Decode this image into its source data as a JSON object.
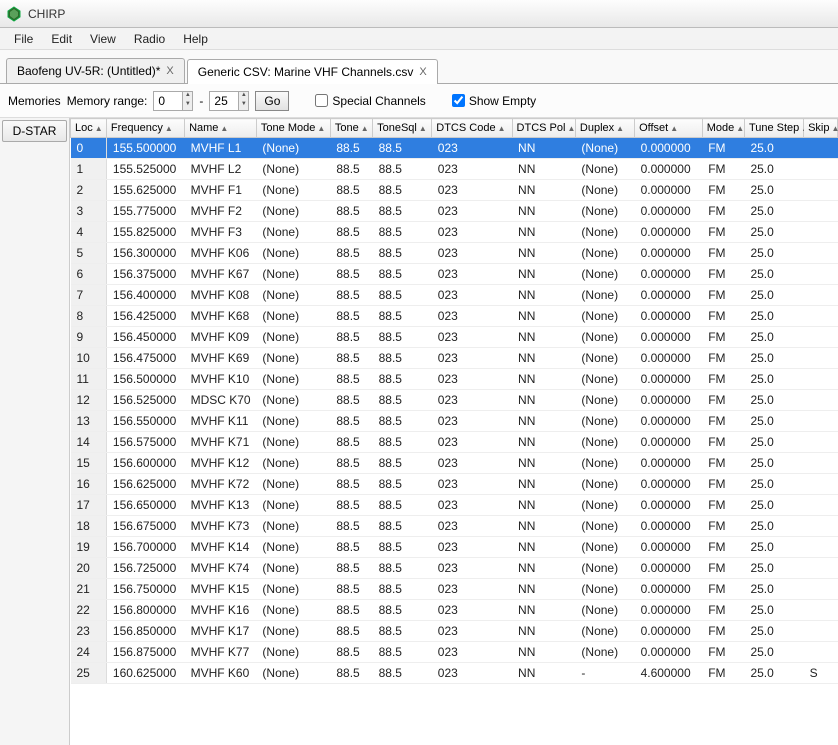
{
  "title": "CHIRP",
  "menu": [
    "File",
    "Edit",
    "View",
    "Radio",
    "Help"
  ],
  "tabs": [
    {
      "label": "Baofeng UV-5R: (Untitled)*",
      "close": "X",
      "active": false
    },
    {
      "label": "Generic CSV: Marine VHF Channels.csv",
      "close": "X",
      "active": true
    }
  ],
  "toolbar": {
    "memories_label": "Memories",
    "range_label": "Memory range:",
    "from": "0",
    "to": "25",
    "go": "Go",
    "dash": "-",
    "special_label": "Special Channels",
    "special_checked": false,
    "show_empty_label": "Show Empty",
    "show_empty_checked": true
  },
  "sidebar": {
    "dstar": "D-STAR"
  },
  "columns": [
    "Loc",
    "Frequency",
    "Name",
    "Tone Mode",
    "Tone",
    "ToneSql",
    "DTCS Code",
    "DTCS Pol",
    "Duplex",
    "Offset",
    "Mode",
    "Tune Step",
    "Skip"
  ],
  "rows": [
    {
      "loc": "0",
      "freq": "155.500000",
      "name": "MVHF L1",
      "tmode": "(None)",
      "tone": "88.5",
      "tsql": "88.5",
      "dtcs": "023",
      "pol": "NN",
      "dup": "(None)",
      "off": "0.000000",
      "mode": "FM",
      "tstep": "25.0",
      "skip": ""
    },
    {
      "loc": "1",
      "freq": "155.525000",
      "name": "MVHF L2",
      "tmode": "(None)",
      "tone": "88.5",
      "tsql": "88.5",
      "dtcs": "023",
      "pol": "NN",
      "dup": "(None)",
      "off": "0.000000",
      "mode": "FM",
      "tstep": "25.0",
      "skip": ""
    },
    {
      "loc": "2",
      "freq": "155.625000",
      "name": "MVHF F1",
      "tmode": "(None)",
      "tone": "88.5",
      "tsql": "88.5",
      "dtcs": "023",
      "pol": "NN",
      "dup": "(None)",
      "off": "0.000000",
      "mode": "FM",
      "tstep": "25.0",
      "skip": ""
    },
    {
      "loc": "3",
      "freq": "155.775000",
      "name": "MVHF F2",
      "tmode": "(None)",
      "tone": "88.5",
      "tsql": "88.5",
      "dtcs": "023",
      "pol": "NN",
      "dup": "(None)",
      "off": "0.000000",
      "mode": "FM",
      "tstep": "25.0",
      "skip": ""
    },
    {
      "loc": "4",
      "freq": "155.825000",
      "name": "MVHF F3",
      "tmode": "(None)",
      "tone": "88.5",
      "tsql": "88.5",
      "dtcs": "023",
      "pol": "NN",
      "dup": "(None)",
      "off": "0.000000",
      "mode": "FM",
      "tstep": "25.0",
      "skip": ""
    },
    {
      "loc": "5",
      "freq": "156.300000",
      "name": "MVHF K06",
      "tmode": "(None)",
      "tone": "88.5",
      "tsql": "88.5",
      "dtcs": "023",
      "pol": "NN",
      "dup": "(None)",
      "off": "0.000000",
      "mode": "FM",
      "tstep": "25.0",
      "skip": ""
    },
    {
      "loc": "6",
      "freq": "156.375000",
      "name": "MVHF K67",
      "tmode": "(None)",
      "tone": "88.5",
      "tsql": "88.5",
      "dtcs": "023",
      "pol": "NN",
      "dup": "(None)",
      "off": "0.000000",
      "mode": "FM",
      "tstep": "25.0",
      "skip": ""
    },
    {
      "loc": "7",
      "freq": "156.400000",
      "name": "MVHF K08",
      "tmode": "(None)",
      "tone": "88.5",
      "tsql": "88.5",
      "dtcs": "023",
      "pol": "NN",
      "dup": "(None)",
      "off": "0.000000",
      "mode": "FM",
      "tstep": "25.0",
      "skip": ""
    },
    {
      "loc": "8",
      "freq": "156.425000",
      "name": "MVHF K68",
      "tmode": "(None)",
      "tone": "88.5",
      "tsql": "88.5",
      "dtcs": "023",
      "pol": "NN",
      "dup": "(None)",
      "off": "0.000000",
      "mode": "FM",
      "tstep": "25.0",
      "skip": ""
    },
    {
      "loc": "9",
      "freq": "156.450000",
      "name": "MVHF K09",
      "tmode": "(None)",
      "tone": "88.5",
      "tsql": "88.5",
      "dtcs": "023",
      "pol": "NN",
      "dup": "(None)",
      "off": "0.000000",
      "mode": "FM",
      "tstep": "25.0",
      "skip": ""
    },
    {
      "loc": "10",
      "freq": "156.475000",
      "name": "MVHF K69",
      "tmode": "(None)",
      "tone": "88.5",
      "tsql": "88.5",
      "dtcs": "023",
      "pol": "NN",
      "dup": "(None)",
      "off": "0.000000",
      "mode": "FM",
      "tstep": "25.0",
      "skip": ""
    },
    {
      "loc": "11",
      "freq": "156.500000",
      "name": "MVHF K10",
      "tmode": "(None)",
      "tone": "88.5",
      "tsql": "88.5",
      "dtcs": "023",
      "pol": "NN",
      "dup": "(None)",
      "off": "0.000000",
      "mode": "FM",
      "tstep": "25.0",
      "skip": ""
    },
    {
      "loc": "12",
      "freq": "156.525000",
      "name": "MDSC K70",
      "tmode": "(None)",
      "tone": "88.5",
      "tsql": "88.5",
      "dtcs": "023",
      "pol": "NN",
      "dup": "(None)",
      "off": "0.000000",
      "mode": "FM",
      "tstep": "25.0",
      "skip": ""
    },
    {
      "loc": "13",
      "freq": "156.550000",
      "name": "MVHF K11",
      "tmode": "(None)",
      "tone": "88.5",
      "tsql": "88.5",
      "dtcs": "023",
      "pol": "NN",
      "dup": "(None)",
      "off": "0.000000",
      "mode": "FM",
      "tstep": "25.0",
      "skip": ""
    },
    {
      "loc": "14",
      "freq": "156.575000",
      "name": "MVHF K71",
      "tmode": "(None)",
      "tone": "88.5",
      "tsql": "88.5",
      "dtcs": "023",
      "pol": "NN",
      "dup": "(None)",
      "off": "0.000000",
      "mode": "FM",
      "tstep": "25.0",
      "skip": ""
    },
    {
      "loc": "15",
      "freq": "156.600000",
      "name": "MVHF K12",
      "tmode": "(None)",
      "tone": "88.5",
      "tsql": "88.5",
      "dtcs": "023",
      "pol": "NN",
      "dup": "(None)",
      "off": "0.000000",
      "mode": "FM",
      "tstep": "25.0",
      "skip": ""
    },
    {
      "loc": "16",
      "freq": "156.625000",
      "name": "MVHF K72",
      "tmode": "(None)",
      "tone": "88.5",
      "tsql": "88.5",
      "dtcs": "023",
      "pol": "NN",
      "dup": "(None)",
      "off": "0.000000",
      "mode": "FM",
      "tstep": "25.0",
      "skip": ""
    },
    {
      "loc": "17",
      "freq": "156.650000",
      "name": "MVHF K13",
      "tmode": "(None)",
      "tone": "88.5",
      "tsql": "88.5",
      "dtcs": "023",
      "pol": "NN",
      "dup": "(None)",
      "off": "0.000000",
      "mode": "FM",
      "tstep": "25.0",
      "skip": ""
    },
    {
      "loc": "18",
      "freq": "156.675000",
      "name": "MVHF K73",
      "tmode": "(None)",
      "tone": "88.5",
      "tsql": "88.5",
      "dtcs": "023",
      "pol": "NN",
      "dup": "(None)",
      "off": "0.000000",
      "mode": "FM",
      "tstep": "25.0",
      "skip": ""
    },
    {
      "loc": "19",
      "freq": "156.700000",
      "name": "MVHF K14",
      "tmode": "(None)",
      "tone": "88.5",
      "tsql": "88.5",
      "dtcs": "023",
      "pol": "NN",
      "dup": "(None)",
      "off": "0.000000",
      "mode": "FM",
      "tstep": "25.0",
      "skip": ""
    },
    {
      "loc": "20",
      "freq": "156.725000",
      "name": "MVHF K74",
      "tmode": "(None)",
      "tone": "88.5",
      "tsql": "88.5",
      "dtcs": "023",
      "pol": "NN",
      "dup": "(None)",
      "off": "0.000000",
      "mode": "FM",
      "tstep": "25.0",
      "skip": ""
    },
    {
      "loc": "21",
      "freq": "156.750000",
      "name": "MVHF K15",
      "tmode": "(None)",
      "tone": "88.5",
      "tsql": "88.5",
      "dtcs": "023",
      "pol": "NN",
      "dup": "(None)",
      "off": "0.000000",
      "mode": "FM",
      "tstep": "25.0",
      "skip": ""
    },
    {
      "loc": "22",
      "freq": "156.800000",
      "name": "MVHF K16",
      "tmode": "(None)",
      "tone": "88.5",
      "tsql": "88.5",
      "dtcs": "023",
      "pol": "NN",
      "dup": "(None)",
      "off": "0.000000",
      "mode": "FM",
      "tstep": "25.0",
      "skip": ""
    },
    {
      "loc": "23",
      "freq": "156.850000",
      "name": "MVHF K17",
      "tmode": "(None)",
      "tone": "88.5",
      "tsql": "88.5",
      "dtcs": "023",
      "pol": "NN",
      "dup": "(None)",
      "off": "0.000000",
      "mode": "FM",
      "tstep": "25.0",
      "skip": ""
    },
    {
      "loc": "24",
      "freq": "156.875000",
      "name": "MVHF K77",
      "tmode": "(None)",
      "tone": "88.5",
      "tsql": "88.5",
      "dtcs": "023",
      "pol": "NN",
      "dup": "(None)",
      "off": "0.000000",
      "mode": "FM",
      "tstep": "25.0",
      "skip": ""
    },
    {
      "loc": "25",
      "freq": "160.625000",
      "name": "MVHF K60",
      "tmode": "(None)",
      "tone": "88.5",
      "tsql": "88.5",
      "dtcs": "023",
      "pol": "NN",
      "dup": "-",
      "off": "4.600000",
      "mode": "FM",
      "tstep": "25.0",
      "skip": "S"
    }
  ]
}
